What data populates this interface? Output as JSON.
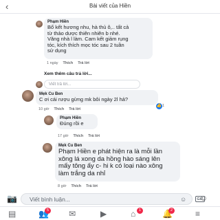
{
  "header": {
    "title": "Bài viết của Hiền",
    "back_icon": "chevron-left-icon"
  },
  "comments": [
    {
      "author": "Phạm Hiền",
      "text": "Bổ kết hương nhu, hà thủ ô,.. tất cả\ntừ thảo dược thiên nhiên b nhé.\nVăng nhà l làm. Cam kết giảm rụng\ntóc, kích thích mọc tóc sau 2 tuần\nsử dụng",
      "time": "1 ngày",
      "like": "Thích",
      "reply": "Trả lời"
    }
  ],
  "more_replies": "Xem thêm câu trả lời...",
  "reply_placeholder_1": "Viết trả lời...",
  "comment2": {
    "author": "Mẹk Cu Ben",
    "text": "C ơi cái rượu gừng mk bôi ngày 2l hả?",
    "time": "10 giờ",
    "like": "Thích",
    "reply": "Trả lời",
    "reaction_count": "1"
  },
  "reply2": {
    "author": "Phạm Hiền",
    "text": "Đúng rồi e",
    "time": "17 giờ",
    "like": "Thích",
    "reply": "Trả lời"
  },
  "comment3": {
    "author": "Mẹk Cu Ben",
    "text": "Phạm Hiền e phát hiện ra là mỗi lần\nxông lá xong da hồng hào sáng lên\nmấy tông ấy c- hi k có loại nào xông\nlàm trắng da nhỉ",
    "time": "8 giờ",
    "like": "Thích",
    "reply": "Trả lời"
  },
  "composer": {
    "placeholder": "Viết bình luận...",
    "gif_label": "GIF"
  },
  "navbar": {
    "badges": [
      "5",
      "1",
      "2"
    ]
  }
}
